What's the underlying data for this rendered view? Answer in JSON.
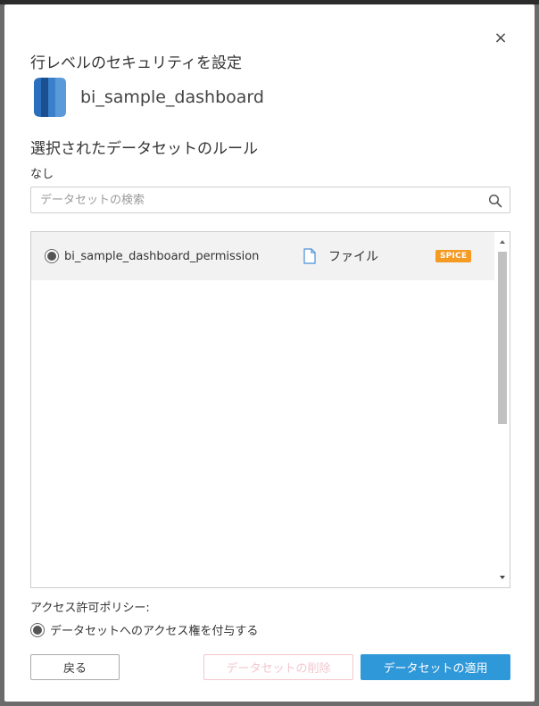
{
  "dialog": {
    "title": "行レベルのセキュリティを設定",
    "close_label": "×",
    "dataset_name": "bi_sample_dashboard",
    "rules_title": "選択されたデータセットのルール",
    "rules_value": "なし"
  },
  "search": {
    "placeholder": "データセットの検索",
    "value": ""
  },
  "datasets": [
    {
      "name": "bi_sample_dashboard_permission",
      "source_type": "ファイル",
      "badge": "SPICE",
      "selected": true
    }
  ],
  "policy": {
    "label": "アクセス許可ポリシー:",
    "option": "データセットへのアクセス権を付与する"
  },
  "buttons": {
    "back": "戻る",
    "delete": "データセットの削除",
    "apply": "データセットの適用"
  },
  "colors": {
    "primary": "#2f98d8",
    "spice_badge": "#f59a23",
    "delete_disabled": "#f3c6ce",
    "selected_row": "#f2f2f2"
  },
  "icons": {
    "close": "close-icon",
    "dataset": "dataset-cylinder-icon",
    "search": "search-icon",
    "file": "file-icon",
    "scroll_up": "scroll-up-arrow-icon",
    "scroll_down": "scroll-down-arrow-icon"
  }
}
